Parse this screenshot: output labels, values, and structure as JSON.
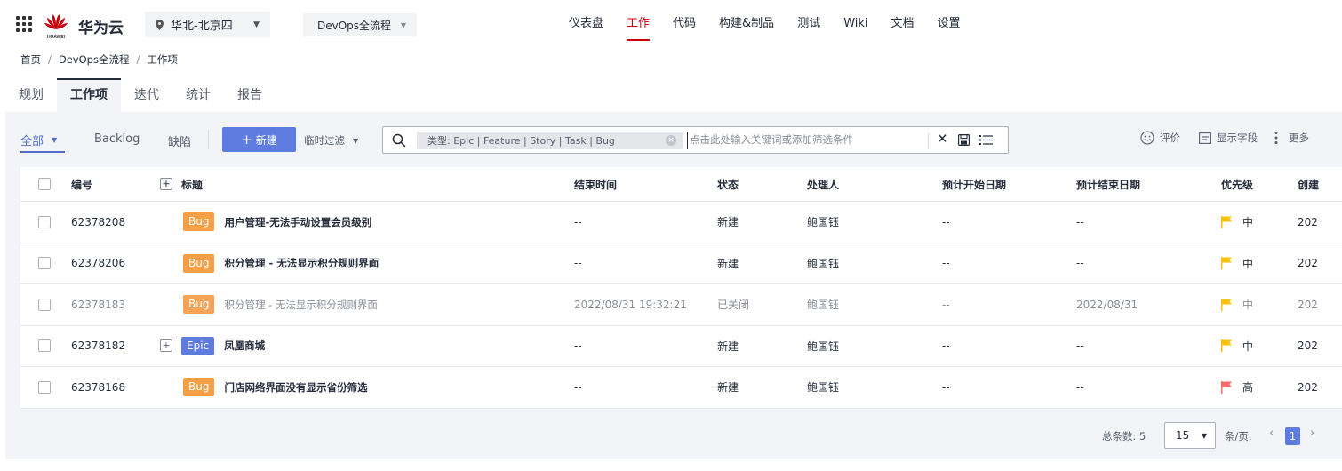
{
  "topbar": {
    "brand": "华为云",
    "logo_text": "HUAWEI",
    "region": "华北-北京四",
    "project": "DevOps全流程",
    "nav": [
      "仪表盘",
      "工作",
      "代码",
      "构建&制品",
      "测试",
      "Wiki",
      "文档",
      "设置"
    ],
    "active_nav": "工作"
  },
  "breadcrumb": [
    "首页",
    "DevOps全流程",
    "工作项"
  ],
  "tabs": [
    "规划",
    "工作项",
    "迭代",
    "统计",
    "报告"
  ],
  "active_tab": "工作项",
  "toolbar": {
    "scope": "全部",
    "backlog": "Backlog",
    "defect": "缺陷",
    "new_label": "新建",
    "temp_filter": "临时过滤",
    "filter_chip": "类型:  Epic  |  Feature  |  Story  |  Task  |  Bug",
    "search_placeholder": "点击此处输入关键词或添加筛选条件",
    "rate": "评价",
    "show_fields": "显示字段",
    "more": "更多"
  },
  "table": {
    "headers": {
      "id": "编号",
      "title": "标题",
      "end_time": "结束时间",
      "status": "状态",
      "assignee": "处理人",
      "plan_start": "预计开始日期",
      "plan_end": "预计结束日期",
      "priority": "优先级",
      "created": "创建"
    },
    "rows": [
      {
        "id": "62378208",
        "type": "Bug",
        "title": "用户管理-无法手动设置会员级别",
        "end_time": "--",
        "status": "新建",
        "assignee": "鲍国钰",
        "plan_start": "--",
        "plan_end": "--",
        "priority": "中",
        "created": "202"
      },
      {
        "id": "62378206",
        "type": "Bug",
        "title": "积分管理 - 无法显示积分规则界面",
        "end_time": "--",
        "status": "新建",
        "assignee": "鲍国钰",
        "plan_start": "--",
        "plan_end": "--",
        "priority": "中",
        "created": "202"
      },
      {
        "id": "62378183",
        "type": "Bug",
        "title": "积分管理 - 无法显示积分规则界面",
        "end_time": "2022/08/31 19:32:21",
        "status": "已关闭",
        "assignee": "鲍国钰",
        "plan_start": "--",
        "plan_end": "2022/08/31",
        "priority": "中",
        "created": "202"
      },
      {
        "id": "62378182",
        "type": "Epic",
        "title": "凤凰商城",
        "end_time": "--",
        "status": "新建",
        "assignee": "鲍国钰",
        "plan_start": "--",
        "plan_end": "--",
        "priority": "中",
        "created": "202"
      },
      {
        "id": "62378168",
        "type": "Bug",
        "title": "门店网络界面没有显示省份筛选",
        "end_time": "--",
        "status": "新建",
        "assignee": "鲍国钰",
        "plan_start": "--",
        "plan_end": "--",
        "priority": "高",
        "created": "202"
      }
    ]
  },
  "pagination": {
    "total_label": "总条数: 5",
    "page_size": "15",
    "per_page_label": "条/页,",
    "current_page": "1",
    "prev": "‹",
    "next": "›"
  },
  "colors": {
    "accent_red": "#c7000b",
    "primary_blue": "#5e7ce0",
    "bug_orange": "#f59f46",
    "flag_medium": "#fac20a",
    "flag_high": "#f66f6a"
  }
}
